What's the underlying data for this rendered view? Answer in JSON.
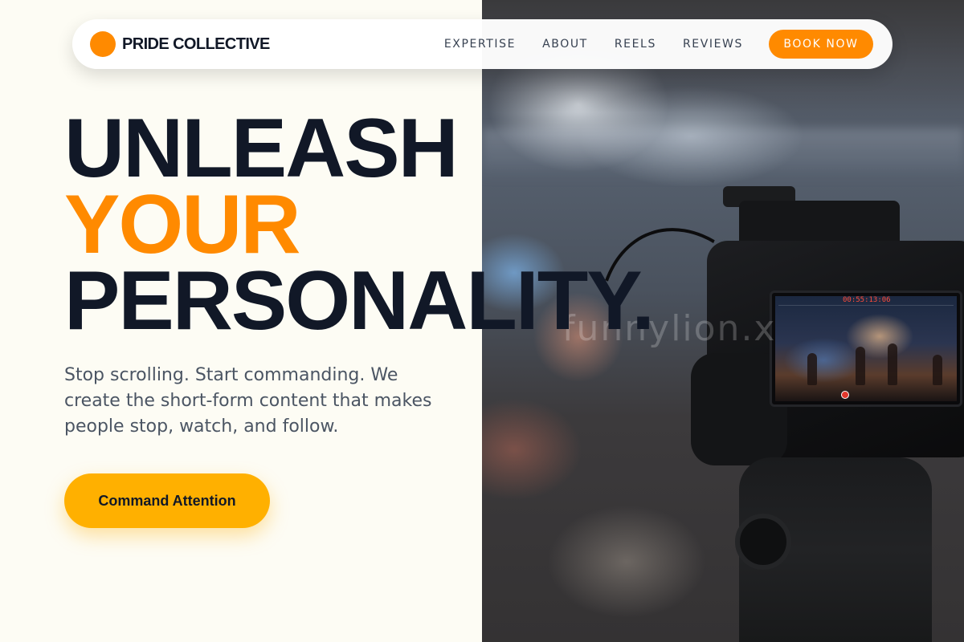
{
  "brand": {
    "name": "PRIDE COLLECTIVE",
    "accent": "#ff8a00"
  },
  "nav": {
    "links": [
      "EXPERTISE",
      "ABOUT",
      "REELS",
      "REVIEWS"
    ],
    "cta_label": "BOOK NOW"
  },
  "hero": {
    "title_line_1": "UNLEASH",
    "title_line_2": "YOUR",
    "title_line_3": "PERSONALITY.",
    "subtitle": "Stop scrolling. Start commanding. We create the short-form content that makes people stop, watch, and follow.",
    "cta_label": "Command Attention",
    "title_color": "#111827",
    "highlight_color": "#ff8a00",
    "cta_color": "#ffb000"
  },
  "media": {
    "description_icon": "camera-rig-image",
    "monitor_timecode": "00:55:13:06",
    "watermark": "funnylion.x"
  }
}
